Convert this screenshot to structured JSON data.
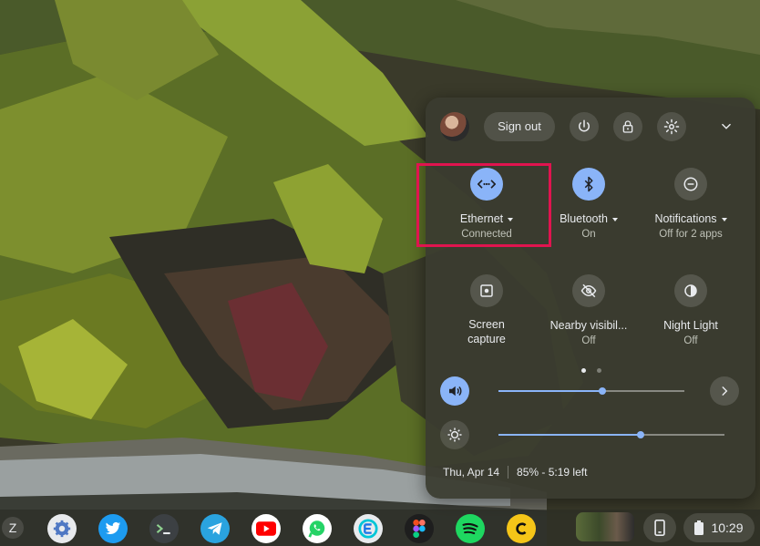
{
  "header": {
    "sign_out_label": "Sign out"
  },
  "tiles": [
    {
      "label": "Ethernet",
      "sub": "Connected",
      "icon": "ethernet-icon",
      "active": true,
      "has_menu": true
    },
    {
      "label": "Bluetooth",
      "sub": "On",
      "icon": "bluetooth-icon",
      "active": true,
      "has_menu": true
    },
    {
      "label": "Notifications",
      "sub": "Off for 2 apps",
      "icon": "do-not-disturb-icon",
      "active": false,
      "has_menu": true
    },
    {
      "label": "Screen capture",
      "sub": "",
      "icon": "screen-capture-icon",
      "active": false,
      "has_menu": false
    },
    {
      "label": "Nearby visibil...",
      "sub": "Off",
      "icon": "visibility-off-icon",
      "active": false,
      "has_menu": false
    },
    {
      "label": "Night Light",
      "sub": "Off",
      "icon": "night-light-icon",
      "active": false,
      "has_menu": false
    }
  ],
  "sliders": {
    "volume_fraction": 0.56,
    "brightness_fraction": 0.63
  },
  "footer": {
    "date": "Thu, Apr 14",
    "battery": "85% - 5:19 left"
  },
  "shelf": {
    "launcher_label": "Z",
    "apps": [
      "settings-icon",
      "twitter-icon",
      "terminal-icon",
      "telegram-icon",
      "youtube-icon",
      "whatsapp-icon",
      "evernote-icon",
      "figma-icon",
      "spotify-icon",
      "c-app-icon"
    ],
    "time": "10:29"
  },
  "colors": {
    "accent": "#8ab4f8",
    "highlight": "#e0144f"
  }
}
